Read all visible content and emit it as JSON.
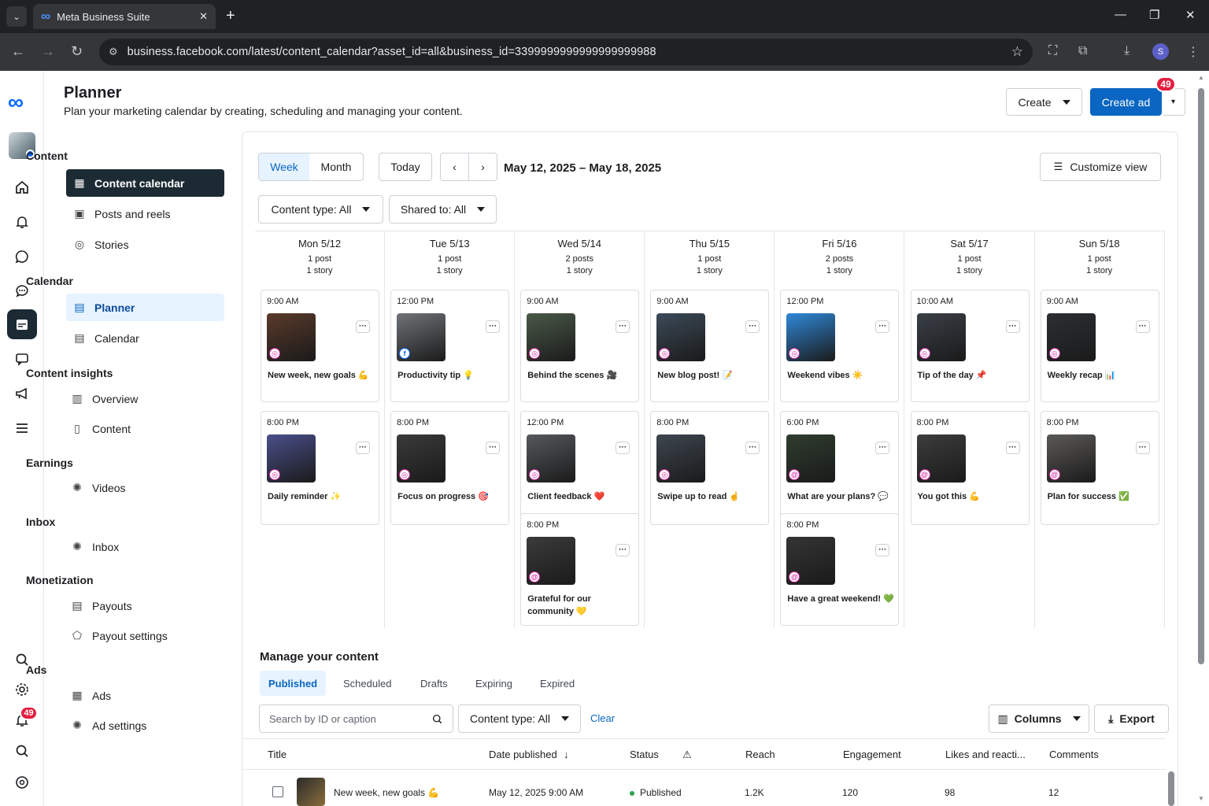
{
  "browser": {
    "tab_title": "Meta Business Suite",
    "url": "business.facebook.com/latest/content_calendar?asset_id=all&business_id=3399999999999999999988",
    "profile_initial": "S"
  },
  "rail": {
    "notification_count": "49"
  },
  "sidebar": {
    "sections": {
      "content": "Content",
      "calendar": "Calendar",
      "insights": "Content insights",
      "earnings": "Earnings",
      "inbox": "Inbox",
      "monetization": "Monetization",
      "ads": "Ads"
    },
    "items": {
      "content_calendar": "Content calendar",
      "posts_reels": "Posts and reels",
      "stories": "Stories",
      "planner": "Planner",
      "calendar": "Calendar",
      "overview": "Overview",
      "content": "Content",
      "videos": "Videos",
      "inbox": "Inbox",
      "payouts": "Payouts",
      "payout_settings": "Payout settings",
      "ads": "Ads",
      "ad_settings": "Ad settings"
    }
  },
  "header": {
    "title": "Planner",
    "subtitle": "Plan your marketing calendar by creating, scheduling and managing your content.",
    "create_label": "Create",
    "create_ad_label": "Create ad",
    "badge_count": "49"
  },
  "toolbar": {
    "week": "Week",
    "month": "Month",
    "today": "Today",
    "date_range": "May 12, 2025 – May 18, 2025",
    "customize": "Customize view",
    "content_type": "Content type: All",
    "shared_to": "Shared to: All"
  },
  "days": [
    {
      "name": "Mon 5/12",
      "posts": "1 post",
      "stories": "1 story"
    },
    {
      "name": "Tue 5/13",
      "posts": "1 post",
      "stories": "1 story"
    },
    {
      "name": "Wed 5/14",
      "posts": "2 posts",
      "stories": "1 story"
    },
    {
      "name": "Thu 5/15",
      "posts": "1 post",
      "stories": "1 story"
    },
    {
      "name": "Fri 5/16",
      "posts": "2 posts",
      "stories": "1 story"
    },
    {
      "name": "Sat 5/17",
      "posts": "1 post",
      "stories": "1 story"
    },
    {
      "name": "Sun 5/18",
      "posts": "1 post",
      "stories": "1 story"
    }
  ],
  "cards": [
    {
      "day": 0,
      "row": 0,
      "time": "9:00 AM",
      "caption": "New week, new goals 💪",
      "platform": "instagram",
      "thumb": "#5a3a2a"
    },
    {
      "day": 1,
      "row": 0,
      "time": "12:00 PM",
      "caption": "Productivity tip 💡",
      "platform": "facebook",
      "thumb": "#707478"
    },
    {
      "day": 2,
      "row": 0,
      "time": "9:00 AM",
      "caption": "Behind the scenes 🎥",
      "platform": "instagram",
      "thumb": "#4a5a48"
    },
    {
      "day": 3,
      "row": 0,
      "time": "9:00 AM",
      "caption": "New blog post! 📝",
      "platform": "instagram",
      "thumb": "#3c4a58"
    },
    {
      "day": 4,
      "row": 0,
      "time": "12:00 PM",
      "caption": "Weekend vibes ☀️",
      "platform": "instagram",
      "thumb": "#2f88d8"
    },
    {
      "day": 5,
      "row": 0,
      "time": "10:00 AM",
      "caption": "Tip of the day 📌",
      "platform": "instagram",
      "thumb": "#3a3f47"
    },
    {
      "day": 6,
      "row": 0,
      "time": "9:00 AM",
      "caption": "Weekly recap 📊",
      "platform": "instagram",
      "thumb": "#2b2f33"
    },
    {
      "day": 0,
      "row": 1,
      "time": "8:00 PM",
      "caption": "Daily reminder ✨",
      "platform": "instagram",
      "thumb": "#4a4f8a"
    },
    {
      "day": 1,
      "row": 1,
      "time": "8:00 PM",
      "caption": "Focus on progress 🎯",
      "platform": "instagram",
      "thumb": "#3a3a3a"
    },
    {
      "day": 2,
      "row": 1,
      "time": "12:00 PM",
      "caption": "Client feedback ❤️",
      "platform": "instagram",
      "thumb": "#55585c"
    },
    {
      "day": 3,
      "row": 1,
      "time": "8:00 PM",
      "caption": "Swipe up to read ☝️",
      "platform": "instagram",
      "thumb": "#3e4650"
    },
    {
      "day": 4,
      "row": 1,
      "time": "6:00 PM",
      "caption": "What are your plans? 💬",
      "platform": "threads",
      "thumb": "#2f3d2f"
    },
    {
      "day": 5,
      "row": 1,
      "time": "8:00 PM",
      "caption": "You got this 💪",
      "platform": "threads",
      "thumb": "#3d3d3d"
    },
    {
      "day": 6,
      "row": 1,
      "time": "8:00 PM",
      "caption": "Plan for success ✅",
      "platform": "threads",
      "thumb": "#5c5a58"
    },
    {
      "day": 2,
      "row": 2,
      "time": "8:00 PM",
      "caption": "Grateful for our community 💛",
      "platform": "threads",
      "thumb": "#3b3b3b"
    },
    {
      "day": 4,
      "row": 2,
      "time": "8:00 PM",
      "caption": "Have a great weekend! 💚",
      "platform": "threads",
      "thumb": "#353535"
    }
  ],
  "manage": {
    "title": "Manage your content",
    "tabs": [
      "Published",
      "Scheduled",
      "Drafts",
      "Expiring",
      "Expired"
    ],
    "search_placeholder": "Search by ID or caption",
    "content_type": "Content type: All",
    "clear": "Clear",
    "columns": "Columns",
    "export": "Export",
    "headers": {
      "title": "Title",
      "date": "Date published",
      "status": "Status",
      "reach": "Reach",
      "engagement": "Engagement",
      "likes": "Likes and reacti...",
      "comments": "Comments"
    },
    "rows": [
      {
        "title": "New week, new goals 💪",
        "date": "May 12, 2025 9:00 AM",
        "status": "Published",
        "reach": "1.2K",
        "engagement": "120",
        "likes": "98",
        "comments": "12"
      }
    ]
  },
  "colors": {
    "brand_blue": "#0a66c2",
    "dark_nav": "#1c2b33",
    "badge_red": "#e41e3f",
    "published_green": "#31a24c"
  }
}
